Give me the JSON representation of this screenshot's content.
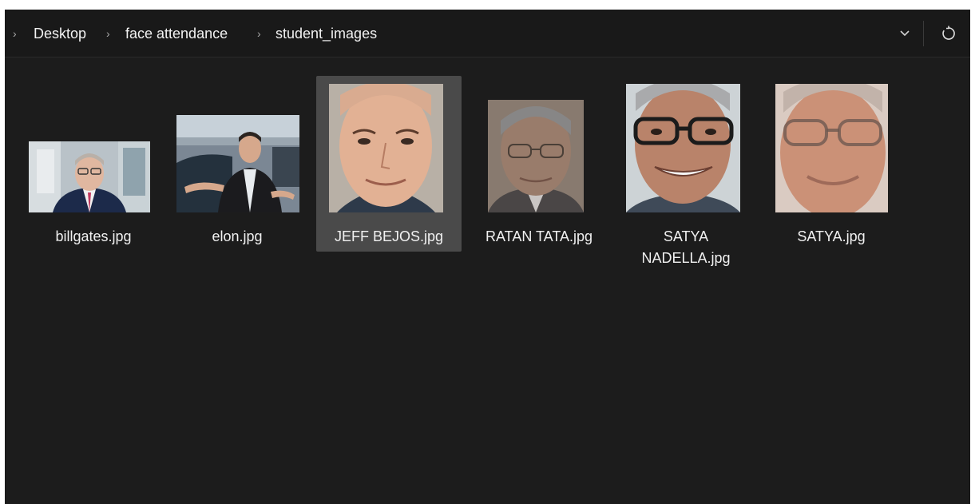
{
  "breadcrumb": {
    "items": [
      "Desktop",
      "face attendance",
      "student_images"
    ]
  },
  "files": [
    {
      "name": "billgates.jpg",
      "thumbnail": "photo-man-suit-glasses",
      "selected": false
    },
    {
      "name": "elon.jpg",
      "thumbnail": "photo-man-suit-car",
      "selected": false
    },
    {
      "name": "JEFF BEJOS.jpg",
      "thumbnail": "photo-face-portrait",
      "selected": true
    },
    {
      "name": "RATAN TATA.jpg",
      "thumbnail": "photo-face-glasses",
      "selected": false
    },
    {
      "name_line1": "SATYA",
      "name_line2": "NADELLA.jpg",
      "thumbnail": "photo-face-glasses-smile",
      "selected": false
    },
    {
      "name": "SATYA.jpg",
      "thumbnail": "photo-face-glasses-blurred",
      "selected": false
    }
  ],
  "colors": {
    "background": "#1c1c1c",
    "address_bar": "#191919",
    "selection": "#4a4a4a",
    "text": "#f0f0f0"
  }
}
